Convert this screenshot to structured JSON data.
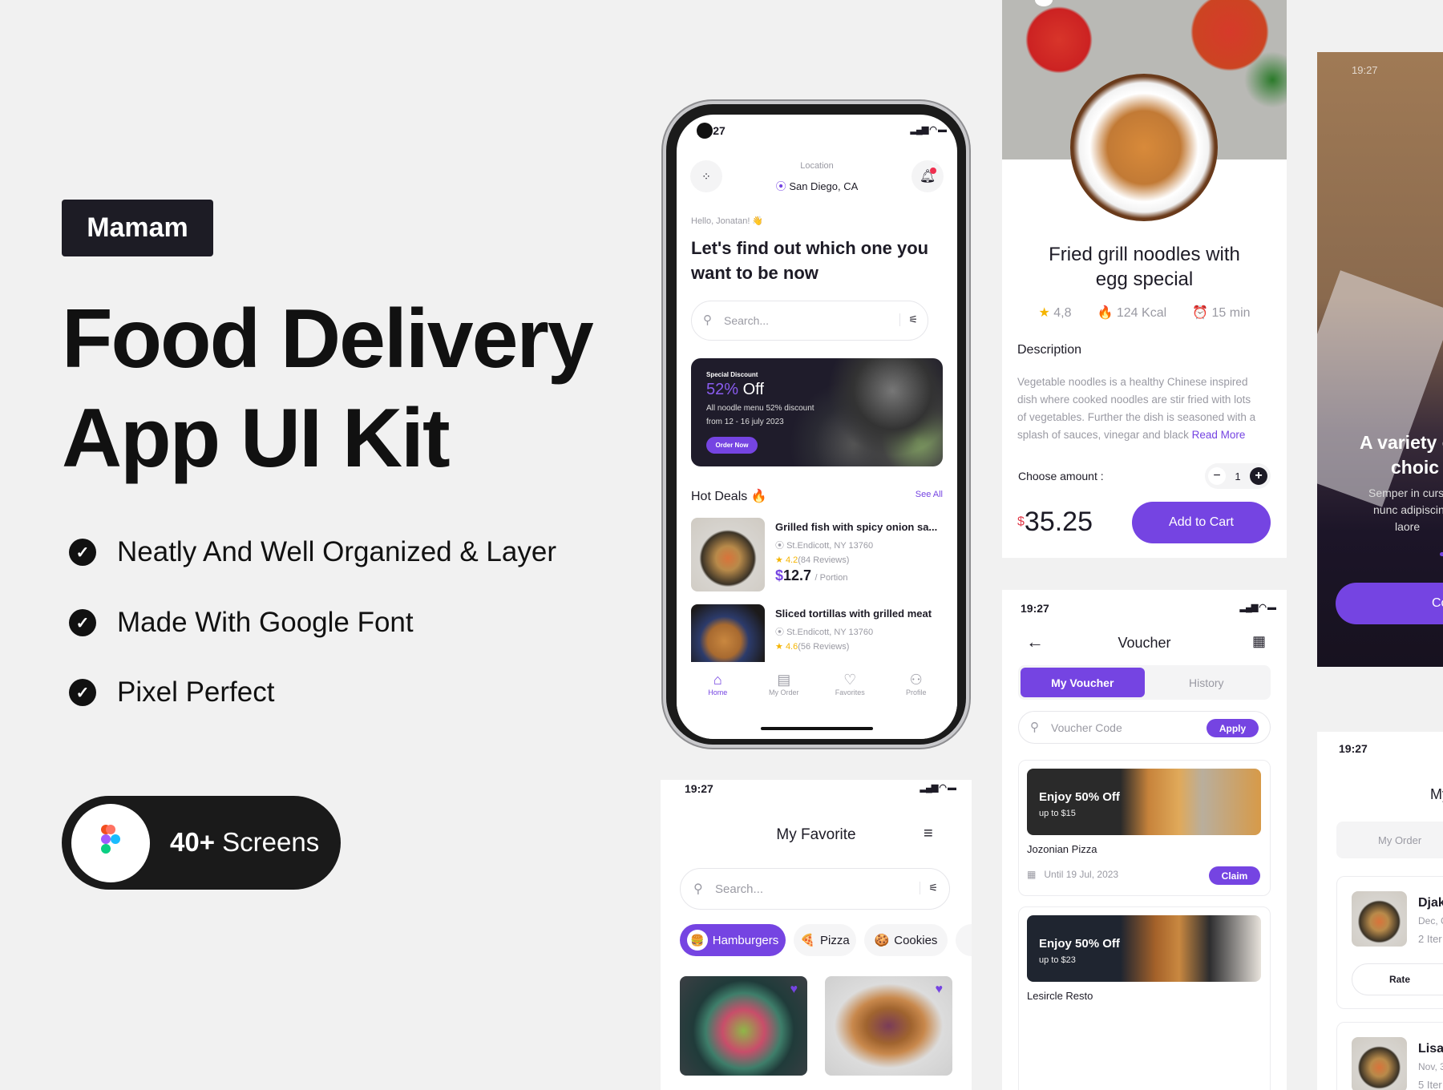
{
  "brand": "Mamam",
  "hero": {
    "line1": "Food Delivery",
    "line2": "App UI Kit"
  },
  "features": [
    "Neatly And Well Organized & Layer",
    "Made With Google Font",
    "Pixel Perfect"
  ],
  "screens_badge": {
    "count": "40+",
    "label": "Screens"
  },
  "colors": {
    "accent": "#7544e2",
    "dark": "#1d1c25",
    "background": "#f1f1f1"
  },
  "home": {
    "time": "19:27",
    "location_label": "Location",
    "location": "San Diego, CA",
    "greeting": "Hello, Jonatan! 👋",
    "heading1": "Let's find out which one you",
    "heading2": "want to be now",
    "search_placeholder": "Search...",
    "banner": {
      "eyebrow": "Special Discount",
      "percent": "52%",
      "off": "Off",
      "line1": "All noodle menu 52% discount",
      "line2": "from 12 - 16 july 2023",
      "button": "Order Now"
    },
    "hot_deals": "Hot Deals 🔥",
    "see_all": "See All",
    "deals": [
      {
        "name": "Grilled fish with spicy onion sa...",
        "address": "St.Endicott, NY 13760",
        "rating": "4.2",
        "reviews": "(84 Reviews)",
        "price": "12.7",
        "unit": "/ Portion"
      },
      {
        "name": "Sliced tortillas with grilled meat",
        "address": "St.Endicott, NY 13760",
        "rating": "4.6",
        "reviews": "(56 Reviews)"
      }
    ],
    "nav": [
      {
        "label": "Home",
        "icon": "home-icon",
        "active": true
      },
      {
        "label": "My Order",
        "icon": "order-icon"
      },
      {
        "label": "Favorites",
        "icon": "heart-icon"
      },
      {
        "label": "Profile",
        "icon": "profile-icon"
      }
    ]
  },
  "detail": {
    "title1": "Fried grill noodles with",
    "title2": "egg special",
    "rating": "4,8",
    "kcal": "124 Kcal",
    "time": "15 min",
    "description_label": "Description",
    "description": [
      "Vegetable noodles is a healthy Chinese inspired",
      "dish where cooked noodles are stir fried with lots",
      "of vegetables. Further the dish is seasoned with a",
      "splash of sauces, vinegar and black"
    ],
    "read_more": "Read More",
    "amount_label": "Choose amount :",
    "amount": "1",
    "currency": "$",
    "price": "35.25",
    "add_to_cart": "Add to Cart"
  },
  "voucher": {
    "time": "19:27",
    "title": "Voucher",
    "tabs": [
      "My Voucher",
      "History"
    ],
    "code_placeholder": "Voucher Code",
    "apply": "Apply",
    "cards": [
      {
        "headline": "Enjoy 50% Off",
        "sub": "up to $15",
        "name": "Jozonian Pizza",
        "until": "Until 19 Jul, 2023",
        "claim": "Claim"
      },
      {
        "headline": "Enjoy 50% Off",
        "sub": "up to $23",
        "name": "Lesircle Resto"
      }
    ]
  },
  "favorite": {
    "time": "19:27",
    "title": "My Favorite",
    "search_placeholder": "Search...",
    "chips": [
      {
        "label": "Hamburgers",
        "emoji": "🍔",
        "active": true
      },
      {
        "label": "Pizza",
        "emoji": "🍕"
      },
      {
        "label": "Cookies",
        "emoji": "🍪"
      }
    ]
  },
  "onboarding": {
    "time": "19:27",
    "title1": "A variety o",
    "title2": "choic",
    "body": [
      "Semper in curs",
      "nunc adipiscin",
      "laore"
    ],
    "button": "Co"
  },
  "orders": {
    "time": "19:27",
    "title": "My",
    "tab": "My Order",
    "items": [
      {
        "name": "Djak",
        "date": "Dec, C",
        "items": "2 Iter",
        "rate": "Rate"
      },
      {
        "name": "Lisal",
        "date": "Nov, 3",
        "items": "5 Iter"
      }
    ]
  }
}
